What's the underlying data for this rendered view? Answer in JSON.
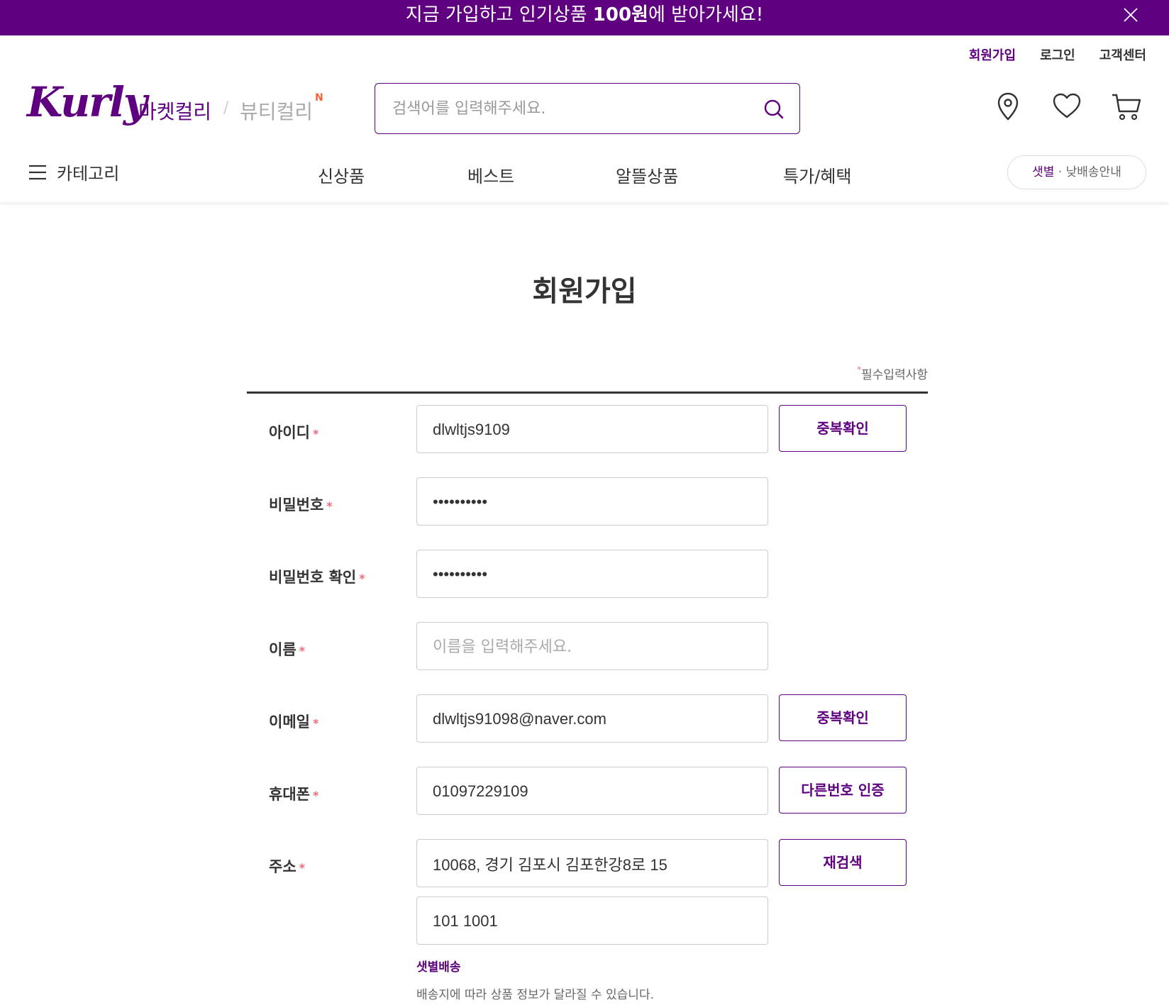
{
  "promo": {
    "text_before": "지금 가입하고 인기상품 ",
    "text_bold": "100원",
    "text_after": "에 받아가세요!"
  },
  "util_links": {
    "signup": "회원가입",
    "login": "로그인",
    "support": "고객센터"
  },
  "brand": {
    "logo": "Kurly",
    "market": "마켓컬리",
    "separator": "/",
    "beauty": "뷰티컬리",
    "beauty_badge": "N"
  },
  "search": {
    "placeholder": "검색어를 입력해주세요."
  },
  "nav": {
    "category": "카테고리",
    "items": [
      "신상품",
      "베스트",
      "알뜰상품",
      "특가/혜택"
    ],
    "delivery_accent": "샛별",
    "delivery_rest": " · 낮배송안내"
  },
  "page": {
    "title": "회원가입",
    "required_note": "필수입력사항",
    "star": "*"
  },
  "form": {
    "id": {
      "label": "아이디",
      "value": "dlwltjs9109",
      "button": "중복확인"
    },
    "password": {
      "label": "비밀번호",
      "value": "••••••••••"
    },
    "password_confirm": {
      "label": "비밀번호 확인",
      "value": "••••••••••"
    },
    "name": {
      "label": "이름",
      "value": "",
      "placeholder": "이름을 입력해주세요."
    },
    "email": {
      "label": "이메일",
      "value": "dlwltjs91098@naver.com",
      "button": "중복확인"
    },
    "phone": {
      "label": "휴대폰",
      "value": "01097229109",
      "button": "다른번호 인증"
    },
    "address": {
      "label": "주소",
      "value": "10068, 경기 김포시 김포한강8로 15",
      "detail": "101 1001",
      "button": "재검색",
      "tag": "샛별배송",
      "note": "배송지에 따라 상품 정보가 달라질 수 있습니다."
    }
  },
  "colors": {
    "brand": "#5f0080",
    "required_star": "#ee6a7b",
    "beauty_badge": "#fa622f"
  }
}
